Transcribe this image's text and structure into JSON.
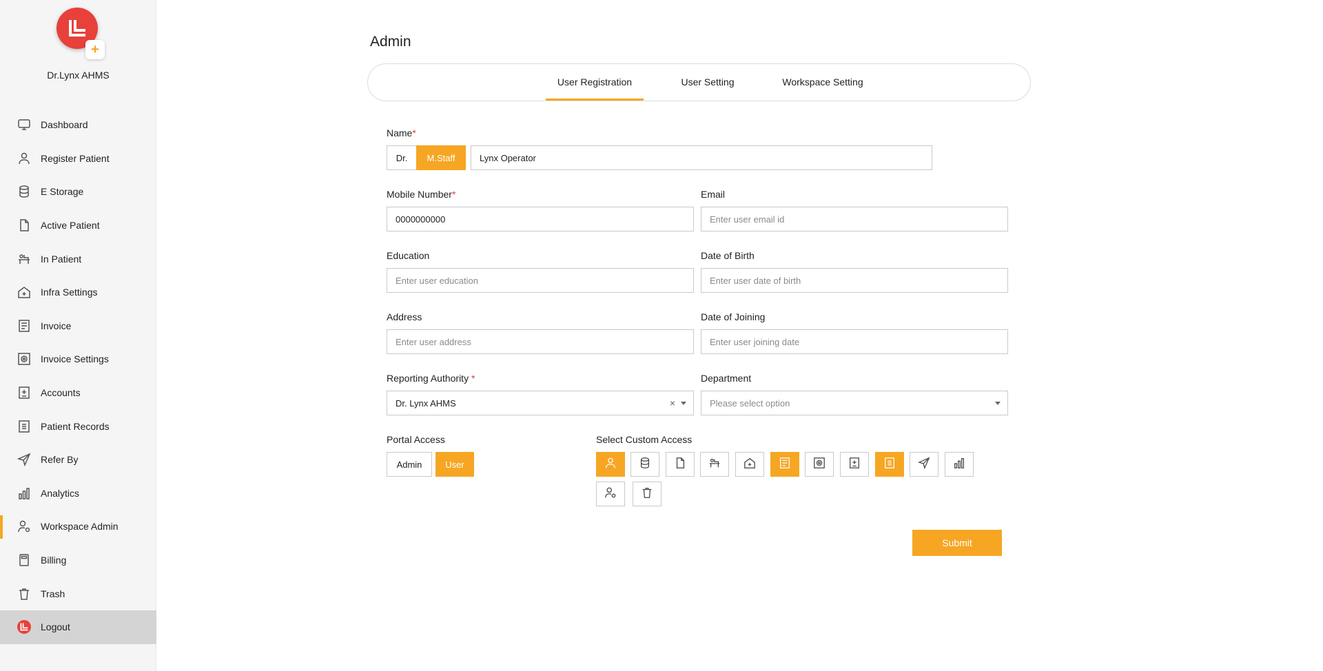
{
  "sidebar": {
    "brand": "Dr.Lynx AHMS",
    "logo_plus": "+",
    "items": [
      {
        "label": "Dashboard",
        "icon": "monitor-icon"
      },
      {
        "label": "Register Patient",
        "icon": "user-icon"
      },
      {
        "label": "E Storage",
        "icon": "database-icon"
      },
      {
        "label": "Active Patient",
        "icon": "file-icon"
      },
      {
        "label": "In Patient",
        "icon": "bed-icon"
      },
      {
        "label": "Infra Settings",
        "icon": "home-plus-icon"
      },
      {
        "label": "Invoice",
        "icon": "invoice-icon"
      },
      {
        "label": "Invoice Settings",
        "icon": "settings-box-icon"
      },
      {
        "label": "Accounts",
        "icon": "accounts-icon"
      },
      {
        "label": "Patient Records",
        "icon": "records-icon"
      },
      {
        "label": "Refer By",
        "icon": "send-icon"
      },
      {
        "label": "Analytics",
        "icon": "bar-chart-icon"
      },
      {
        "label": "Workspace Admin",
        "icon": "user-settings-icon"
      },
      {
        "label": "Billing",
        "icon": "calculator-icon"
      },
      {
        "label": "Trash",
        "icon": "trash-icon"
      },
      {
        "label": "Logout",
        "icon": "logout-logo-icon"
      }
    ],
    "active_index": 12
  },
  "page": {
    "title": "Admin",
    "tabs": [
      {
        "label": "User Registration"
      },
      {
        "label": "User Setting"
      },
      {
        "label": "Workspace Setting"
      }
    ],
    "active_tab": 0
  },
  "form": {
    "name_label": "Name",
    "required_mark": "*",
    "title_options": [
      "Dr.",
      "M.Staff"
    ],
    "title_selected": "M.Staff",
    "name_value": "Lynx Operator",
    "mobile_label": "Mobile Number",
    "mobile_value": "0000000000",
    "email_label": "Email",
    "email_placeholder": "Enter user email id",
    "education_label": "Education",
    "education_placeholder": "Enter user education",
    "dob_label": "Date of Birth",
    "dob_placeholder": "Enter user date of birth",
    "address_label": "Address",
    "address_placeholder": "Enter user address",
    "doj_label": "Date of Joining",
    "doj_placeholder": "Enter user joining date",
    "reporting_label": "Reporting Authority",
    "reporting_value": "Dr. Lynx AHMS",
    "clear_symbol": "×",
    "department_label": "Department",
    "department_placeholder": "Please select option",
    "portal_label": "Portal Access",
    "portal_options": [
      "Admin",
      "User"
    ],
    "portal_selected": "User",
    "custom_access_label": "Select Custom Access",
    "custom_access": [
      {
        "icon": "user-icon",
        "selected": true
      },
      {
        "icon": "database-icon",
        "selected": false
      },
      {
        "icon": "file-icon",
        "selected": false
      },
      {
        "icon": "bed-icon",
        "selected": false
      },
      {
        "icon": "home-plus-icon",
        "selected": false
      },
      {
        "icon": "invoice-icon",
        "selected": true
      },
      {
        "icon": "settings-box-icon",
        "selected": false
      },
      {
        "icon": "accounts-icon",
        "selected": false
      },
      {
        "icon": "records-icon",
        "selected": true
      },
      {
        "icon": "send-icon",
        "selected": false
      },
      {
        "icon": "bar-chart-icon",
        "selected": false
      },
      {
        "icon": "user-settings-icon",
        "selected": false
      },
      {
        "icon": "trash-icon",
        "selected": false
      }
    ],
    "submit_label": "Submit"
  },
  "colors": {
    "accent": "#f6a623",
    "logo": "#e8403a",
    "required": "#e53935"
  }
}
